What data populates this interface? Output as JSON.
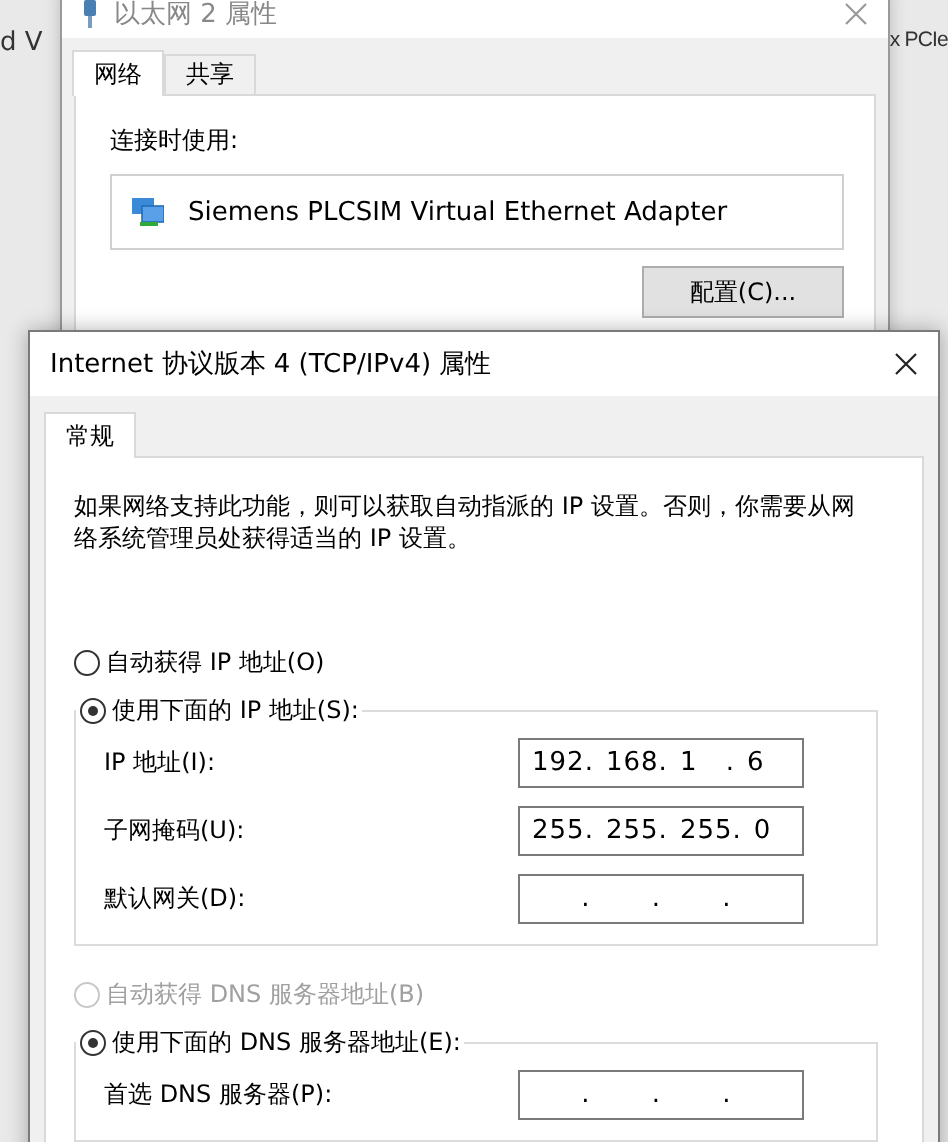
{
  "background": {
    "texts": [
      "d V",
      "x PCIe"
    ]
  },
  "back_window": {
    "title": "以太网 2 属性",
    "tabs": [
      {
        "label": "网络",
        "selected": true
      },
      {
        "label": "共享",
        "selected": false
      }
    ],
    "connect_label": "连接时使用:",
    "adapter": "Siemens PLCSIM Virtual Ethernet Adapter",
    "configure_button": "配置(C)..."
  },
  "dialog": {
    "title": "Internet 协议版本 4 (TCP/IPv4) 属性",
    "tabs": [
      {
        "label": "常规",
        "selected": true
      }
    ],
    "description": "如果网络支持此功能，则可以获取自动指派的 IP 设置。否则，你需要从网络系统管理员处获得适当的 IP 设置。",
    "separator": ".",
    "ip_mode": [
      {
        "label": "自动获得 IP 地址(O)",
        "selected": false,
        "disabled": false
      },
      {
        "label": "使用下面的 IP 地址(S):",
        "selected": true,
        "disabled": false
      }
    ],
    "ip_fields": [
      {
        "label": "IP 地址(I):",
        "octets": [
          "192",
          "168",
          "1",
          "6"
        ]
      },
      {
        "label": "子网掩码(U):",
        "octets": [
          "255",
          "255",
          "255",
          "0"
        ]
      },
      {
        "label": "默认网关(D):"
      }
    ],
    "dns_mode": [
      {
        "label": "自动获得 DNS 服务器地址(B)",
        "selected": false,
        "disabled": true
      },
      {
        "label": "使用下面的 DNS 服务器地址(E):",
        "selected": true,
        "disabled": false
      }
    ],
    "dns_fields": [
      {
        "label": "首选 DNS 服务器(P):"
      }
    ]
  }
}
